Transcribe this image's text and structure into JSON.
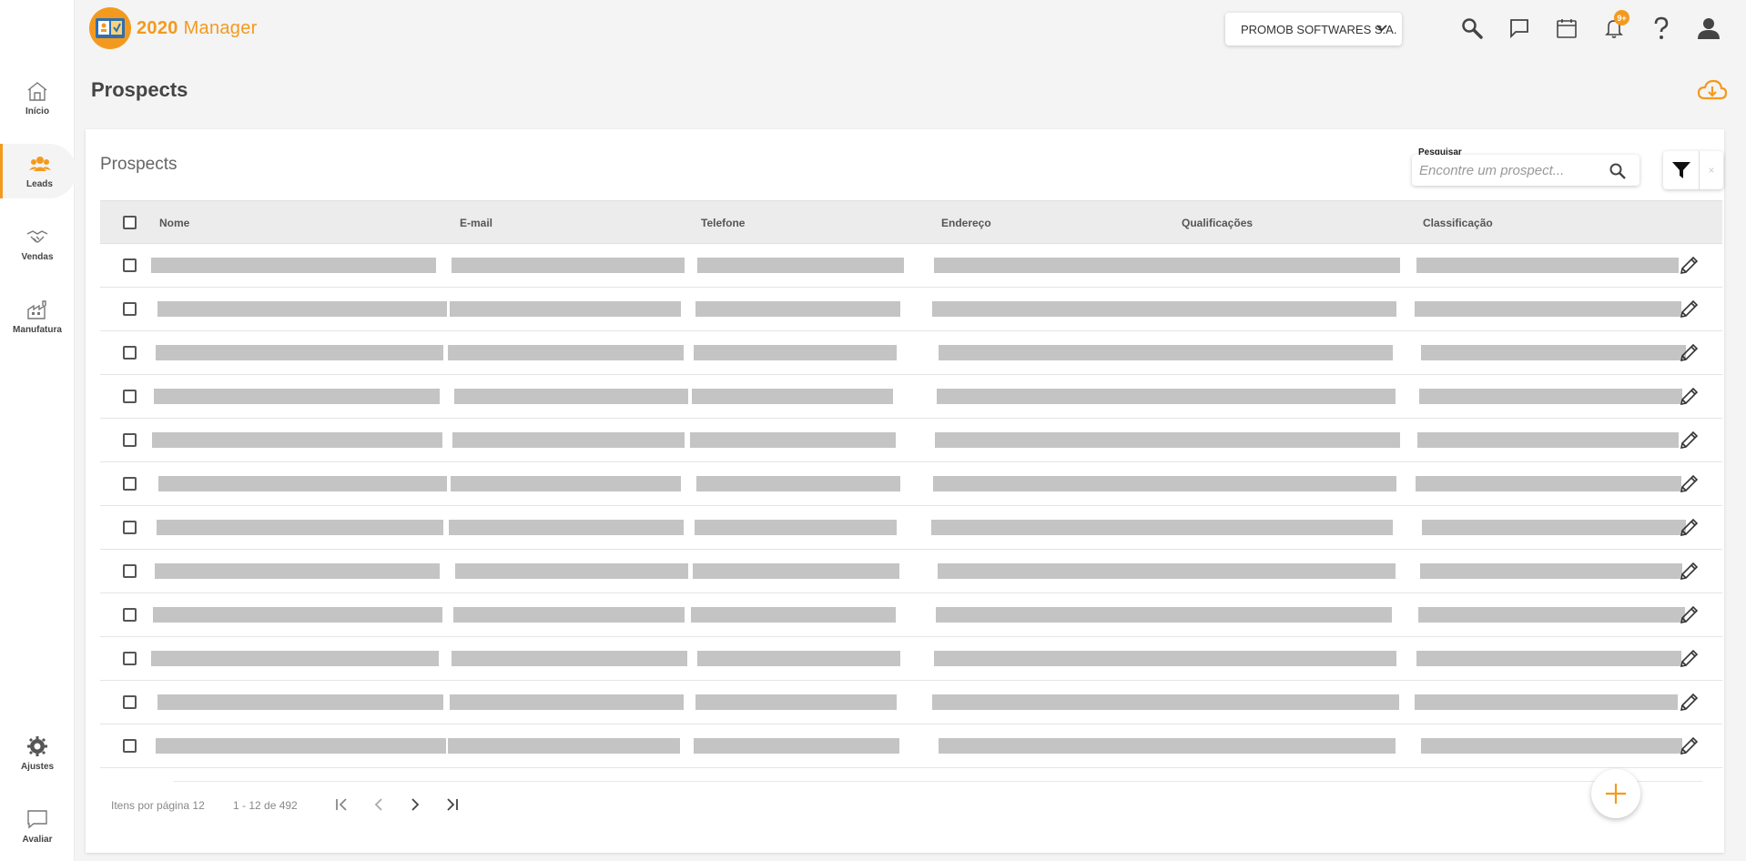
{
  "app": {
    "logo_number": "2020",
    "logo_word": "Manager"
  },
  "sidebar": {
    "items": [
      {
        "label": "Início",
        "icon": "home-icon"
      },
      {
        "label": "Leads",
        "icon": "people-icon",
        "active": true
      },
      {
        "label": "Vendas",
        "icon": "handshake-icon"
      },
      {
        "label": "Manufatura",
        "icon": "factory-icon"
      }
    ],
    "bottom": [
      {
        "label": "Ajustes",
        "icon": "gear-icon"
      },
      {
        "label": "Avaliar",
        "icon": "chat-icon"
      }
    ]
  },
  "header": {
    "company": "PROMOB SOFTWARES S.A.",
    "notification_badge": "9+"
  },
  "page": {
    "title": "Prospects"
  },
  "card": {
    "title": "Prospects",
    "search": {
      "label": "Pesquisar",
      "placeholder": "Encontre um prospect..."
    },
    "filter_clear": "×"
  },
  "table": {
    "columns": [
      "Nome",
      "E-mail",
      "Telefone",
      "Endereço",
      "Qualificações",
      "Classificação"
    ],
    "row_count": 12
  },
  "pagination": {
    "items_per_page_label": "Itens por página 12",
    "range": "1 - 12 de 492"
  },
  "colors": {
    "accent": "#f39a1e",
    "placeholder": "#c4c4c4"
  }
}
